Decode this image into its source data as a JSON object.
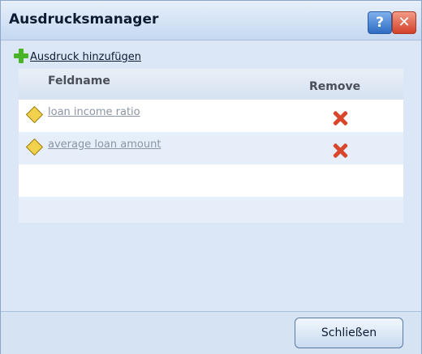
{
  "window": {
    "title": "Ausdrucksmanager",
    "help_label": "?",
    "close_label": "✕"
  },
  "toolbar": {
    "add_label": "Ausdruck hinzufügen",
    "add_icon": "plus-icon",
    "add_icon_color": "#49b526"
  },
  "table": {
    "headers": {
      "name": "Feldname",
      "remove": "Remove"
    },
    "rows": [
      {
        "name": "loan income ratio",
        "icon": "diamond-icon",
        "remove_icon": "remove-icon"
      },
      {
        "name": "average loan amount",
        "icon": "diamond-icon",
        "remove_icon": "remove-icon"
      }
    ]
  },
  "footer": {
    "close_button": "Schließen"
  },
  "colors": {
    "accent_blue": "#2f6cc4",
    "close_red": "#d3402a",
    "remove_red": "#d8472c",
    "diamond_yellow": "#f2d24c"
  }
}
